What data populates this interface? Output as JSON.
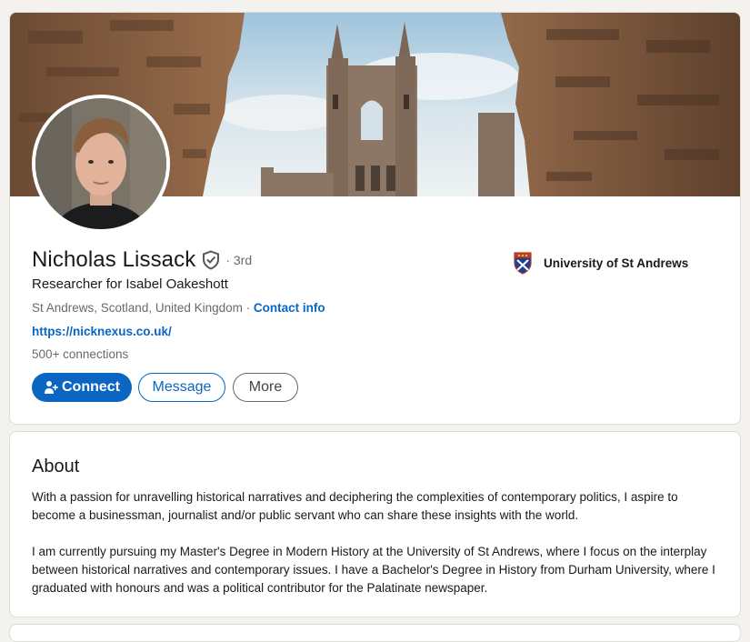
{
  "profile": {
    "name": "Nicholas Lissack",
    "degree": "· 3rd",
    "headline": "Researcher for Isabel Oakeshott",
    "location": "St Andrews, Scotland, United Kingdom",
    "separator": " · ",
    "contact_info": "Contact info",
    "website": "https://nicknexus.co.uk/",
    "connections": "500+ connections",
    "education": "University of St Andrews"
  },
  "actions": {
    "connect": "Connect",
    "message": "Message",
    "more": "More"
  },
  "about": {
    "title": "About",
    "paragraph1": "With a passion for unravelling historical narratives and deciphering the complexities of contemporary politics, I aspire to become a businessman, journalist and/or public servant who can share these insights with the world.",
    "paragraph2": "I am currently pursuing my Master's Degree in Modern History at the University of St Andrews, where I focus on the interplay between historical narratives and contemporary issues. I have a Bachelor's Degree in History from Durham University, where I graduated with honours and was a political contributor for the Palatinate newspaper."
  },
  "colors": {
    "brand_blue": "#0a66c2",
    "page_bg": "#f3f2ef"
  },
  "icons": {
    "verify": "verified-shield-icon",
    "connect": "add-person-icon",
    "university": "university-crest-icon"
  }
}
